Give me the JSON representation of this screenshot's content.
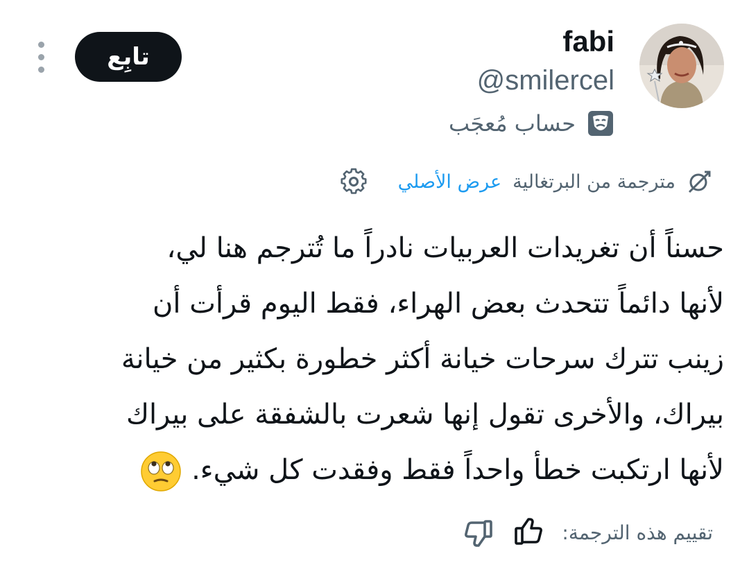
{
  "profile": {
    "name": "fabi",
    "handle": "@smilercel",
    "parody_label": "حساب مُعجَب",
    "follow_label": "تابِع"
  },
  "translation": {
    "status": "مترجمة من البرتغالية",
    "show_original": "عرض الأصلي"
  },
  "tweet": {
    "lines": [
      "حسناً أن تغريدات العربيات نادراً ما تُترجم هنا لي،",
      "لأنها دائماً تتحدث بعض الهراء، فقط اليوم قرأت أن",
      "زينب تترك سرحات خيانة أكثر خطورة بكثير من خيانة",
      "بيراك، والأخرى تقول إنها شعرت بالشفقة على بيراك",
      "لأنها ارتكبت خطأ واحداً فقط وفقدت كل شيء."
    ],
    "emoji": "eye-roll-emoji"
  },
  "rating": {
    "label": "تقييم هذه الترجمة:"
  },
  "icons": {
    "more": "more-vertical-icon",
    "parody": "theater-masks-icon",
    "translate": "translate-icon",
    "settings": "gear-icon",
    "like": "thumbs-up-icon",
    "dislike": "thumbs-down-icon"
  },
  "colors": {
    "text": "#0f1419",
    "secondary": "#536471",
    "link": "#1d9bf0",
    "button": "#0f1419"
  }
}
